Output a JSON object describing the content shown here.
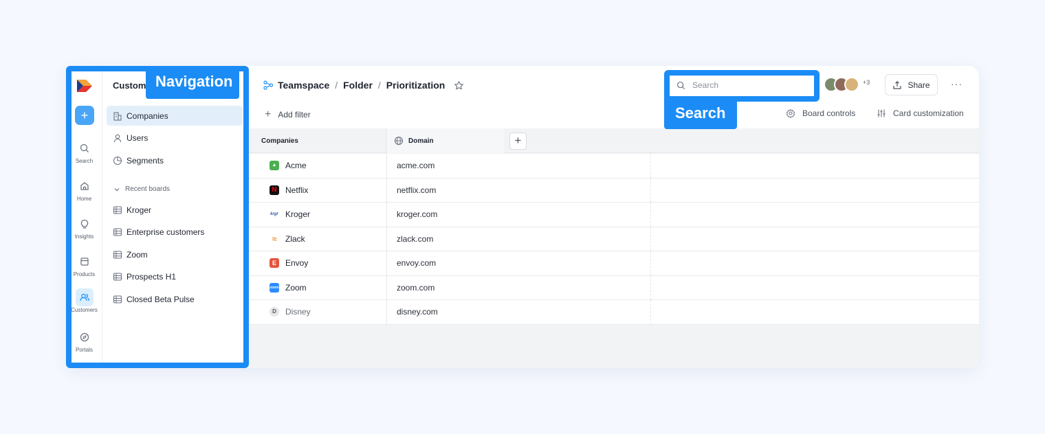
{
  "rail": {
    "items": [
      {
        "label": "Search",
        "icon": "search-icon"
      },
      {
        "label": "Home",
        "icon": "home-icon"
      },
      {
        "label": "Insights",
        "icon": "lightbulb-icon"
      },
      {
        "label": "Products",
        "icon": "box-icon"
      },
      {
        "label": "Customers",
        "icon": "users-icon",
        "active": true
      },
      {
        "label": "Portals",
        "icon": "compass-icon"
      }
    ],
    "add_label": "+"
  },
  "nav": {
    "title": "Custom",
    "items": [
      {
        "label": "Companies",
        "icon": "building-icon",
        "active": true
      },
      {
        "label": "Users",
        "icon": "user-icon"
      },
      {
        "label": "Segments",
        "icon": "pie-icon"
      }
    ],
    "recent_label": "Recent boards",
    "recent": [
      {
        "label": "Kroger"
      },
      {
        "label": "Enterprise customers"
      },
      {
        "label": "Zoom"
      },
      {
        "label": "Prospects H1"
      },
      {
        "label": "Closed Beta Pulse"
      }
    ]
  },
  "highlights": {
    "navigation_label": "Navigation",
    "search_label": "Search",
    "color": "#1b8cf5"
  },
  "breadcrumb": {
    "items": [
      "Teamspace",
      "Folder",
      "Prioritization"
    ],
    "sep": "/"
  },
  "toolbar": {
    "add_filter": "Add filter",
    "search_placeholder": "Search",
    "avatars_more": "+3",
    "share": "Share",
    "more": "···",
    "board_controls": "Board controls",
    "card_customization": "Card customization"
  },
  "table": {
    "col_company": "Companies",
    "col_domain": "Domain",
    "add_col": "+",
    "rows": [
      {
        "name": "Acme",
        "domain": "acme.com",
        "color": "#4caf50"
      },
      {
        "name": "Netflix",
        "domain": "netflix.com",
        "color": "#111111"
      },
      {
        "name": "Kroger",
        "domain": "kroger.com",
        "color": "#ffffff"
      },
      {
        "name": "Zlack",
        "domain": "zlack.com",
        "color": "#ffffff"
      },
      {
        "name": "Envoy",
        "domain": "envoy.com",
        "color": "#e5533d"
      },
      {
        "name": "Zoom",
        "domain": "zoom.com",
        "color": "#2d8cff"
      },
      {
        "name": "Disney",
        "domain": "disney.com",
        "color": "#e6e7e9"
      }
    ]
  }
}
